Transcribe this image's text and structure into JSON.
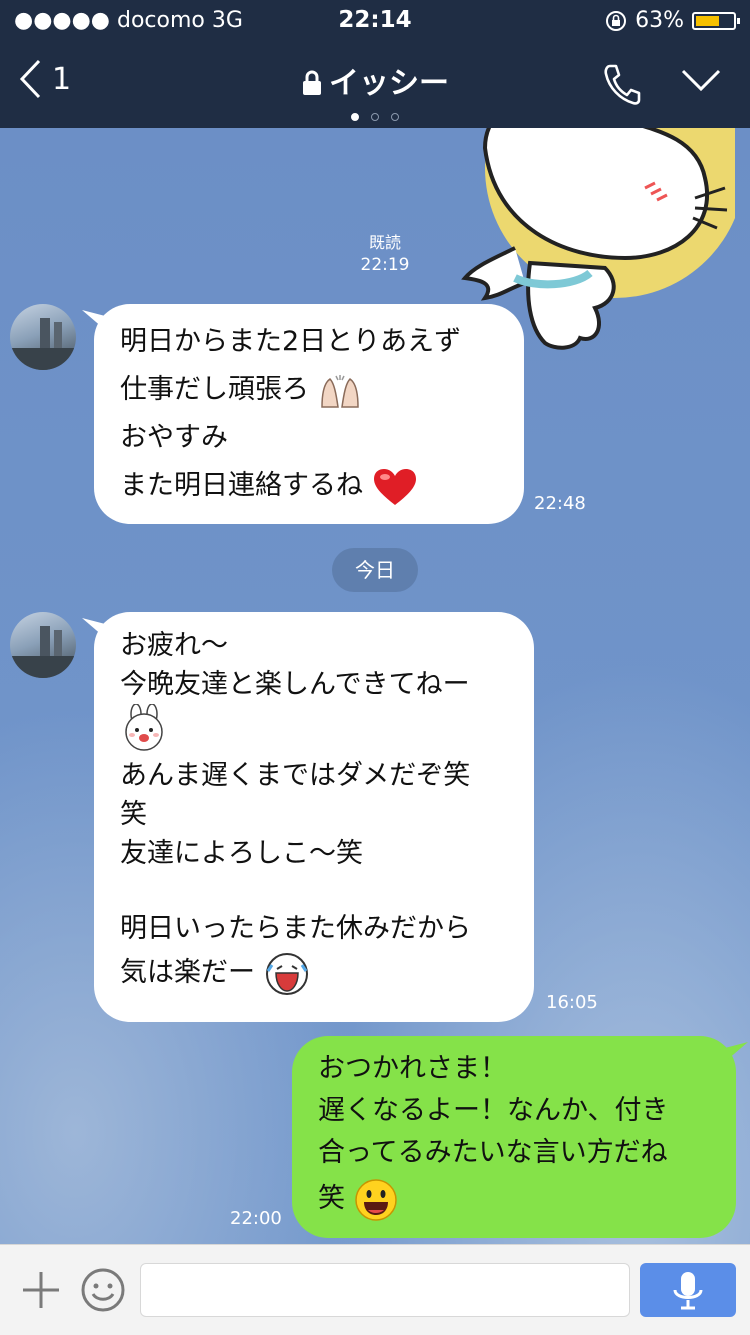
{
  "status_bar": {
    "carrier": "●●●●● docomo  3G",
    "time": "22:14",
    "battery": "63%",
    "battery_level": 0.63
  },
  "header": {
    "back_count": "1",
    "title": "イッシー",
    "page_dots": 3,
    "active_dot": 0
  },
  "messages": {
    "read_label": "既読",
    "read_time": "22:19",
    "m1": {
      "lines": [
        "明日からまた2日とりあえず",
        "仕事だし頑張ろ",
        "おやすみ",
        "また明日連絡するね"
      ],
      "time": "22:48"
    },
    "date_divider": "今日",
    "m2": {
      "lines": [
        "お疲れ〜",
        "今晩友達と楽しんできてねー",
        "",
        "あんま遅くまではダメだぞ笑",
        "笑",
        "友達によろしこ〜笑",
        "",
        "明日いったらまた休みだから",
        "気は楽だー"
      ],
      "time": "16:05"
    },
    "m3": {
      "lines": [
        "おつかれさま！",
        "遅くなるよー！なんか、付き",
        "合ってるみたいな言い方だね",
        "笑"
      ],
      "time": "22:00"
    }
  },
  "input": {
    "placeholder": ""
  },
  "colors": {
    "bar": "#1f2d44",
    "me_bubble": "#85e249",
    "send": "#5b8ee8"
  }
}
